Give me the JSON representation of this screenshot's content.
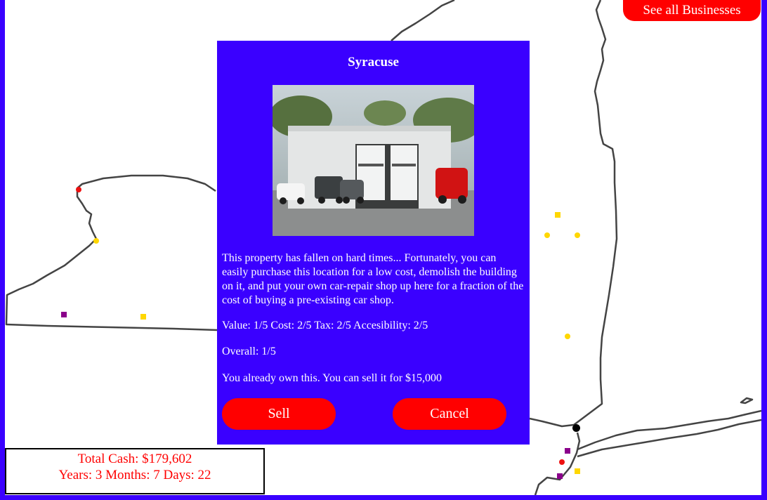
{
  "header": {
    "see_all_label": "See all Businesses"
  },
  "modal": {
    "title": "Syracuse",
    "description": "This property has fallen on hard times... Fortunately, you can easily purchase this location for a low cost, demolish the building on it, and put your own car-repair shop up here for a fraction of the cost of buying a pre-existing car shop.",
    "ratings_text": "Value: 1/5 Cost: 2/5 Tax: 2/5 Accesibility: 2/5",
    "overall_text": "Overall: 1/5",
    "ownership_text": "You already own this. You can sell it for $15,000",
    "sell_label": "Sell",
    "cancel_label": "Cancel"
  },
  "status": {
    "cash_text": "Total Cash: $179,602",
    "time_text": "Years: 3 Months: 7 Days: 22"
  },
  "colors": {
    "background": "#3a00ff",
    "button": "#ff0000",
    "marker_red": "#ee1111",
    "marker_yellow": "#ffd700",
    "marker_purple": "#8b008b",
    "marker_black": "#000000"
  },
  "map_markers": [
    {
      "name": "marker-red-circle",
      "color": "marker_red"
    },
    {
      "name": "marker-yellow-circle",
      "color": "marker_yellow"
    },
    {
      "name": "marker-purple-square",
      "color": "marker_purple"
    },
    {
      "name": "marker-yellow-square",
      "color": "marker_yellow"
    },
    {
      "name": "marker-yellow-square",
      "color": "marker_yellow"
    },
    {
      "name": "marker-yellow-circle",
      "color": "marker_yellow"
    },
    {
      "name": "marker-yellow-circle",
      "color": "marker_yellow"
    },
    {
      "name": "marker-yellow-circle",
      "color": "marker_yellow"
    },
    {
      "name": "marker-black-circle",
      "color": "marker_black"
    },
    {
      "name": "marker-purple-square",
      "color": "marker_purple"
    },
    {
      "name": "marker-red-circle",
      "color": "marker_red"
    },
    {
      "name": "marker-yellow-square",
      "color": "marker_yellow"
    },
    {
      "name": "marker-purple-square",
      "color": "marker_purple"
    }
  ]
}
